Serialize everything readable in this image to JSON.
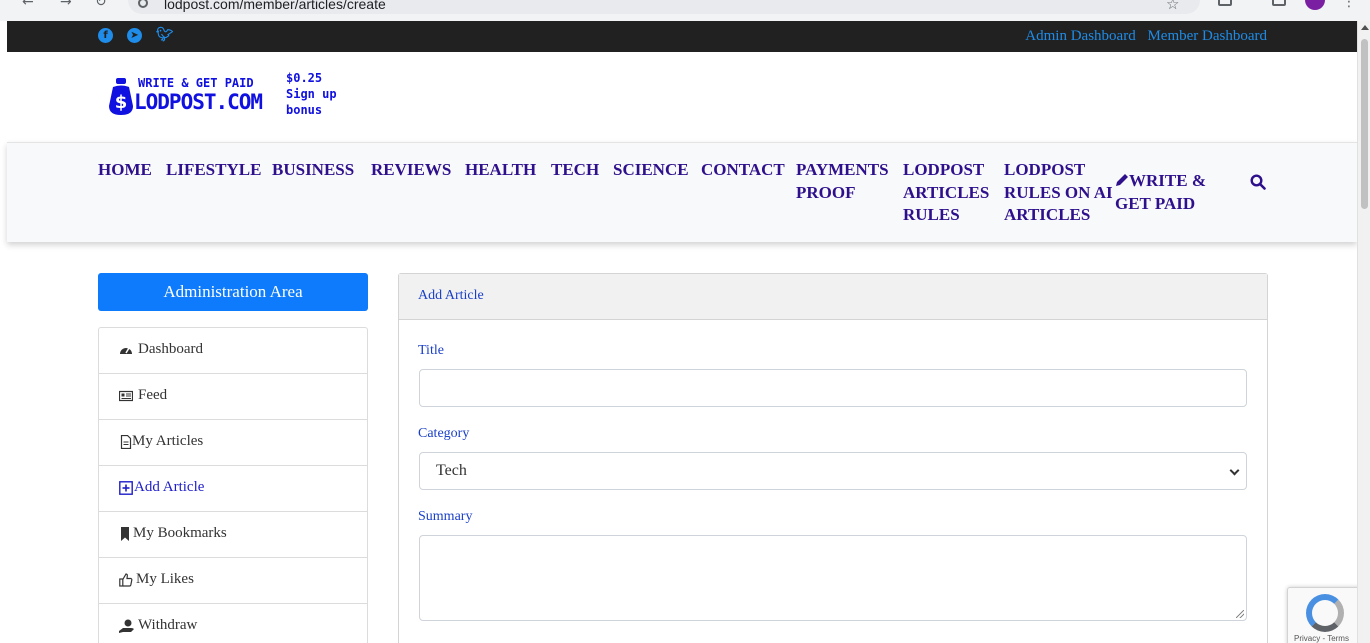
{
  "browser": {
    "url": "lodpost.com/member/articles/create"
  },
  "topbar": {
    "social_icons": [
      "facebook-icon",
      "telegram-icon",
      "twitter-icon"
    ],
    "links": [
      "Admin Dashboard",
      "Member Dashboard"
    ]
  },
  "logo": {
    "tagline": "WRITE & GET PAID",
    "name": "LODPOST.COM",
    "bonus_line1": "$0.25",
    "bonus_line2": "Sign up",
    "bonus_line3": "bonus"
  },
  "nav": {
    "home": "HOME",
    "lifestyle": "LIFESTYLE",
    "business": "BUSINESS",
    "reviews": "REVIEWS",
    "health": "HEALTH",
    "tech": "TECH",
    "science": "SCIENCE",
    "contact": "CONTACT",
    "payments_1": "PAYMENTS",
    "payments_2": "PROOF",
    "rules_1": "LODPOST",
    "rules_2": "ARTICLES",
    "rules_3": "RULES",
    "ai_1": "LODPOST",
    "ai_2": "RULES ON AI",
    "ai_3": "ARTICLES",
    "write_1": "WRITE &",
    "write_2": "GET PAID"
  },
  "sidebar": {
    "title": "Administration Area",
    "items": [
      {
        "label": "Dashboard",
        "icon": "gauge-icon"
      },
      {
        "label": "Feed",
        "icon": "newspaper-icon"
      },
      {
        "label": "My Articles",
        "icon": "file-icon"
      },
      {
        "label": "Add Article",
        "icon": "plus-square-icon"
      },
      {
        "label": "My Bookmarks",
        "icon": "bookmark-icon"
      },
      {
        "label": "My Likes",
        "icon": "thumbs-up-icon"
      },
      {
        "label": "Withdraw",
        "icon": "hand-holding-dollar-icon"
      }
    ]
  },
  "form": {
    "header": "Add Article",
    "title_label": "Title",
    "title_value": "",
    "category_label": "Category",
    "category_value": "Tech",
    "summary_label": "Summary",
    "summary_value": ""
  },
  "recaptcha": {
    "text": "Privacy - Terms"
  },
  "colors": {
    "brand_blue": "#1010e0",
    "nav_purple": "#2e108d",
    "primary": "#0d7bfb",
    "link": "#1e8ce8"
  }
}
